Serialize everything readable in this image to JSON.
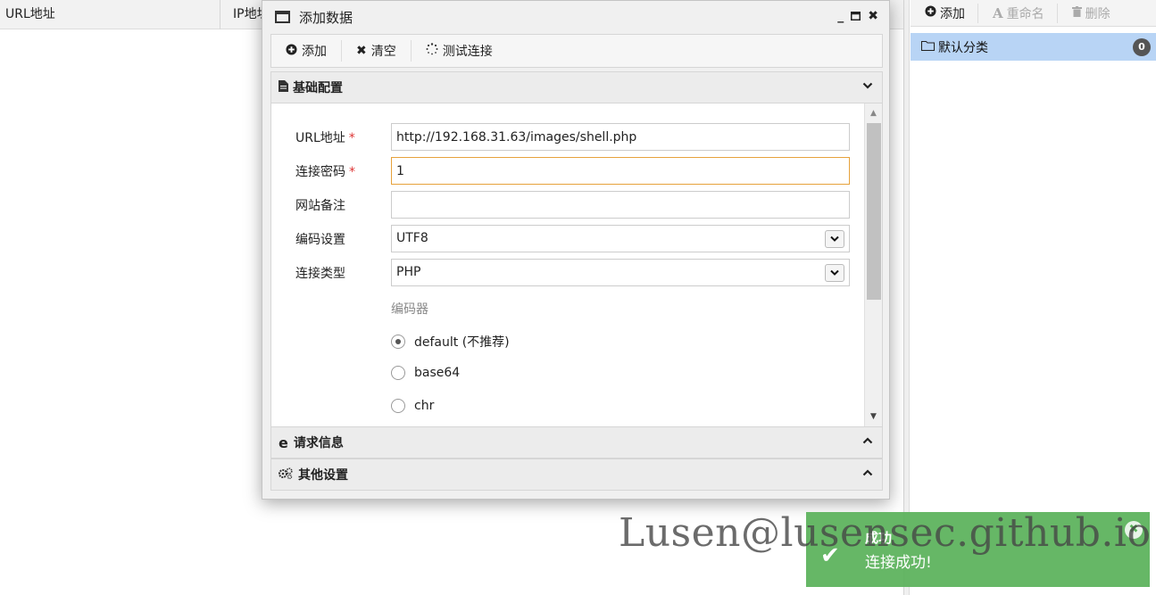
{
  "grid": {
    "columns": [
      "URL地址",
      "IP地址"
    ]
  },
  "categories": {
    "toolbar": {
      "add": "添加",
      "rename": "重命名",
      "delete": "删除"
    },
    "items": [
      {
        "label": "默认分类",
        "count": "0"
      }
    ]
  },
  "dialog": {
    "title": "添加数据",
    "toolbar": {
      "add": "添加",
      "clear": "清空",
      "test": "测试连接"
    },
    "sections": {
      "basic": "基础配置",
      "request": "请求信息",
      "other": "其他设置"
    },
    "form": {
      "url_label": "URL地址",
      "url_value": "http://192.168.31.63/images/shell.php",
      "password_label": "连接密码",
      "password_value": "1",
      "note_label": "网站备注",
      "note_value": "",
      "encoding_label": "编码设置",
      "encoding_value": "UTF8",
      "type_label": "连接类型",
      "type_value": "PHP",
      "required_mark": "*",
      "encoder_label": "编码器",
      "encoders": [
        {
          "label": "default (不推荐)",
          "selected": true
        },
        {
          "label": "base64",
          "selected": false
        },
        {
          "label": "chr",
          "selected": false
        }
      ]
    }
  },
  "watermark": "Lusen@lusensec.github.io",
  "toast": {
    "title": "成功",
    "message": "连接成功!"
  },
  "colors": {
    "selected_row": "#b8d4f5",
    "toast_bg": "#5ab25a",
    "focus_border": "#e6a23c",
    "required": "#dd3333"
  }
}
